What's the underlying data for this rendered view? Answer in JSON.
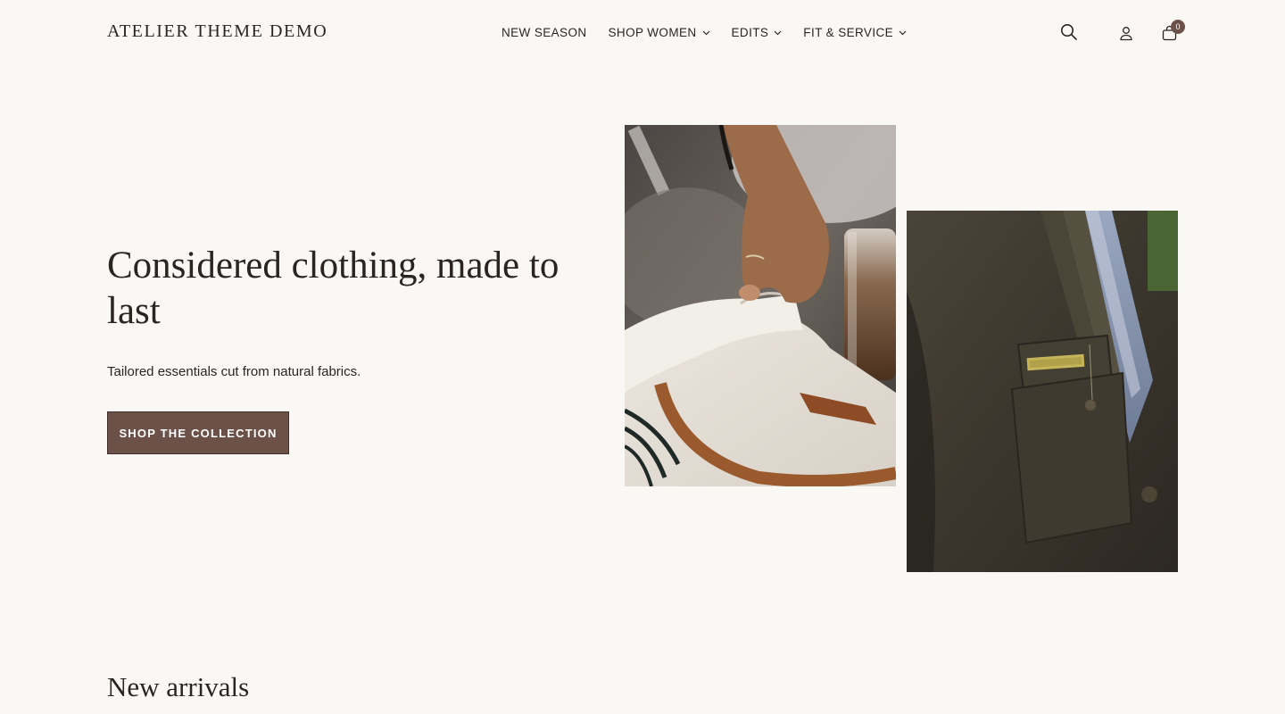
{
  "header": {
    "logo": "ATELIER THEME DEMO",
    "nav": [
      {
        "label": "NEW SEASON",
        "has_dropdown": false
      },
      {
        "label": "SHOP WOMEN",
        "has_dropdown": true
      },
      {
        "label": "EDITS",
        "has_dropdown": true
      },
      {
        "label": "FIT & SERVICE",
        "has_dropdown": true
      }
    ],
    "icons": [
      "search-icon",
      "account-icon",
      "cart-icon"
    ],
    "cart_count": "0"
  },
  "hero": {
    "title": "Considered clothing, made to last",
    "subtitle": "Tailored essentials cut from natural fabrics.",
    "cta_label": "SHOP THE COLLECTION"
  },
  "sections": {
    "new_arrivals_title": "New arrivals"
  },
  "colors": {
    "background": "#f9f8f5",
    "text": "#2b2522",
    "accent": "#6b5148"
  }
}
